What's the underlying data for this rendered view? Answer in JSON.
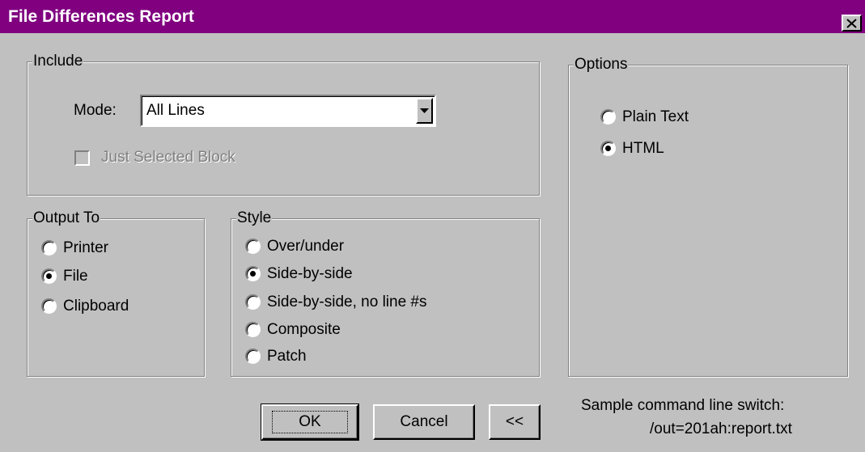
{
  "window": {
    "title": "File Differences Report"
  },
  "include": {
    "legend": "Include",
    "mode_label": "Mode:",
    "mode_value": "All Lines",
    "just_selected_block": {
      "label": "Just Selected Block",
      "checked": false,
      "enabled": false
    }
  },
  "output_to": {
    "legend": "Output To",
    "options": [
      {
        "label": "Printer",
        "checked": false
      },
      {
        "label": "File",
        "checked": true
      },
      {
        "label": "Clipboard",
        "checked": false
      }
    ]
  },
  "style": {
    "legend": "Style",
    "options": [
      {
        "label": "Over/under",
        "checked": false
      },
      {
        "label": "Side-by-side",
        "checked": true
      },
      {
        "label": "Side-by-side, no line #s",
        "checked": false
      },
      {
        "label": "Composite",
        "checked": false
      },
      {
        "label": "Patch",
        "checked": false
      }
    ]
  },
  "options": {
    "legend": "Options",
    "choices": [
      {
        "label": "Plain Text",
        "checked": false
      },
      {
        "label": "HTML",
        "checked": true
      }
    ]
  },
  "buttons": {
    "ok": "OK",
    "cancel": "Cancel",
    "collapse": "<<"
  },
  "sample": {
    "heading": "Sample command line switch:",
    "switch": "/out=201ah:report.txt"
  },
  "colors": {
    "titlebar": "#800080",
    "face": "#c0c0c0"
  }
}
